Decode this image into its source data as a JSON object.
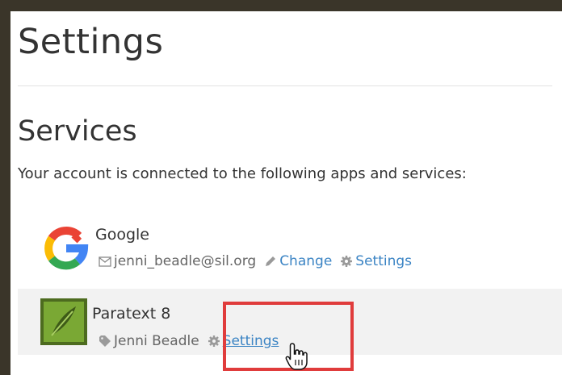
{
  "page": {
    "title": "Settings"
  },
  "services": {
    "heading": "Services",
    "description": "Your account is connected to the following apps and services:",
    "items": [
      {
        "name": "Google",
        "icon": "google-logo-icon",
        "account_icon": "envelope-icon",
        "account": "jenni_beadle@sil.org",
        "change_label": "Change",
        "settings_label": "Settings"
      },
      {
        "name": "Paratext 8",
        "icon": "paratext-logo-icon",
        "account_icon": "tag-icon",
        "account": "Jenni Beadle",
        "settings_label": "Settings"
      }
    ]
  },
  "colors": {
    "link": "#3b84c4",
    "highlight": "#e03c3c",
    "row_background": "#f2f2f2",
    "frame": "#3a3529"
  }
}
